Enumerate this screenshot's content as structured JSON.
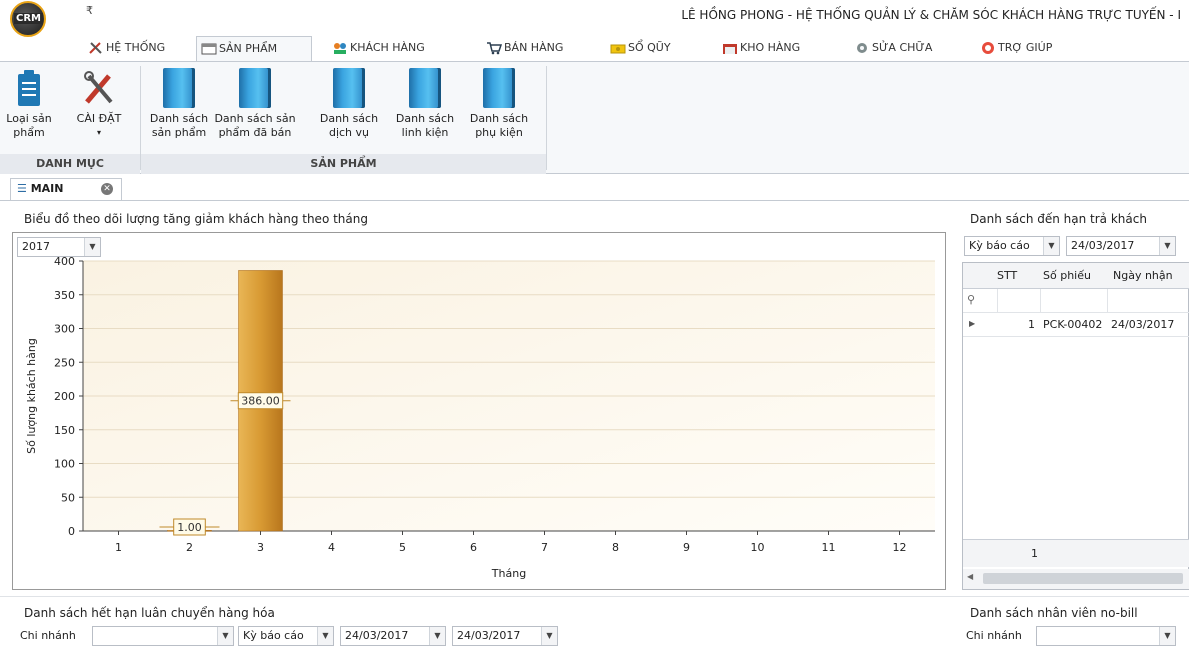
{
  "app": {
    "logo_text": "CRM",
    "qat_symbol": "₹",
    "title": "LÊ HỒNG PHONG - HỆ THỐNG QUẢN LÝ & CHĂM SÓC KHÁCH HÀNG TRỰC TUYẾN - I"
  },
  "tabs": [
    {
      "label": "HỆ THỐNG",
      "icon": "tools-icon"
    },
    {
      "label": "SẢN PHẨM",
      "icon": "product-icon"
    },
    {
      "label": "KHÁCH HÀNG",
      "icon": "customers-icon"
    },
    {
      "label": "BÁN HÀNG",
      "icon": "cart-icon"
    },
    {
      "label": "SỔ QŨY",
      "icon": "cash-icon"
    },
    {
      "label": "KHO HÀNG",
      "icon": "warehouse-icon"
    },
    {
      "label": "SỬA CHỮA",
      "icon": "repair-icon"
    },
    {
      "label": "TRỢ GIÚP",
      "icon": "help-icon"
    }
  ],
  "ribbon": {
    "group1_label": "DANH MỤC",
    "group2_label": "SẢN PHẨM",
    "btn_category": [
      "Loại sản",
      "phẩm"
    ],
    "btn_settings": [
      "CÀI ĐẶT",
      "▾"
    ],
    "btn_products": [
      "Danh sách",
      "sản phẩm"
    ],
    "btn_sold": [
      "Danh sách sản",
      "phẩm đã bán"
    ],
    "btn_services": [
      "Danh sách",
      "dịch vụ"
    ],
    "btn_components": [
      "Danh sách",
      "linh kiện"
    ],
    "btn_accessories": [
      "Danh sách",
      "phụ kiện"
    ]
  },
  "doc_tab": {
    "label": "MAIN"
  },
  "chart_panel": {
    "title": "Biểu đồ theo dõi lượng tăng giảm khách hàng theo tháng",
    "year": "2017"
  },
  "chart_data": {
    "type": "bar",
    "categories": [
      "1",
      "2",
      "3",
      "4",
      "5",
      "6",
      "7",
      "8",
      "9",
      "10",
      "11",
      "12"
    ],
    "values": [
      0,
      1,
      386,
      0,
      0,
      0,
      0,
      0,
      0,
      0,
      0,
      0
    ],
    "data_labels": {
      "2": "1.00",
      "3": "386.00"
    },
    "ylabel": "Số lượng khách hàng",
    "xlabel": "Tháng",
    "yticks": [
      0,
      50,
      100,
      150,
      200,
      250,
      300,
      350,
      400
    ],
    "ylim": [
      0,
      400
    ],
    "grid": true,
    "bar_color": "#d89a33"
  },
  "due_panel": {
    "title": "Danh sách đến hạn trả khách",
    "period_label": "Kỳ báo cáo",
    "date": "24/03/2017",
    "columns": [
      "STT",
      "Số phiếu",
      "Ngày nhận"
    ],
    "rows": [
      {
        "stt": "1",
        "so_phieu": "PCK-00402",
        "ngay_nhan": "24/03/2017"
      }
    ],
    "pager": "1"
  },
  "expire_panel": {
    "title": "Danh sách hết hạn luân chuyển hàng hóa",
    "branch_label": "Chi nhánh",
    "branch_value": "",
    "period_label": "Kỳ báo cáo",
    "date_from": "24/03/2017",
    "date_to": "24/03/2017"
  },
  "nobill_panel": {
    "title": "Danh sách nhân viên no-bill",
    "branch_label": "Chi nhánh",
    "branch_value": ""
  }
}
